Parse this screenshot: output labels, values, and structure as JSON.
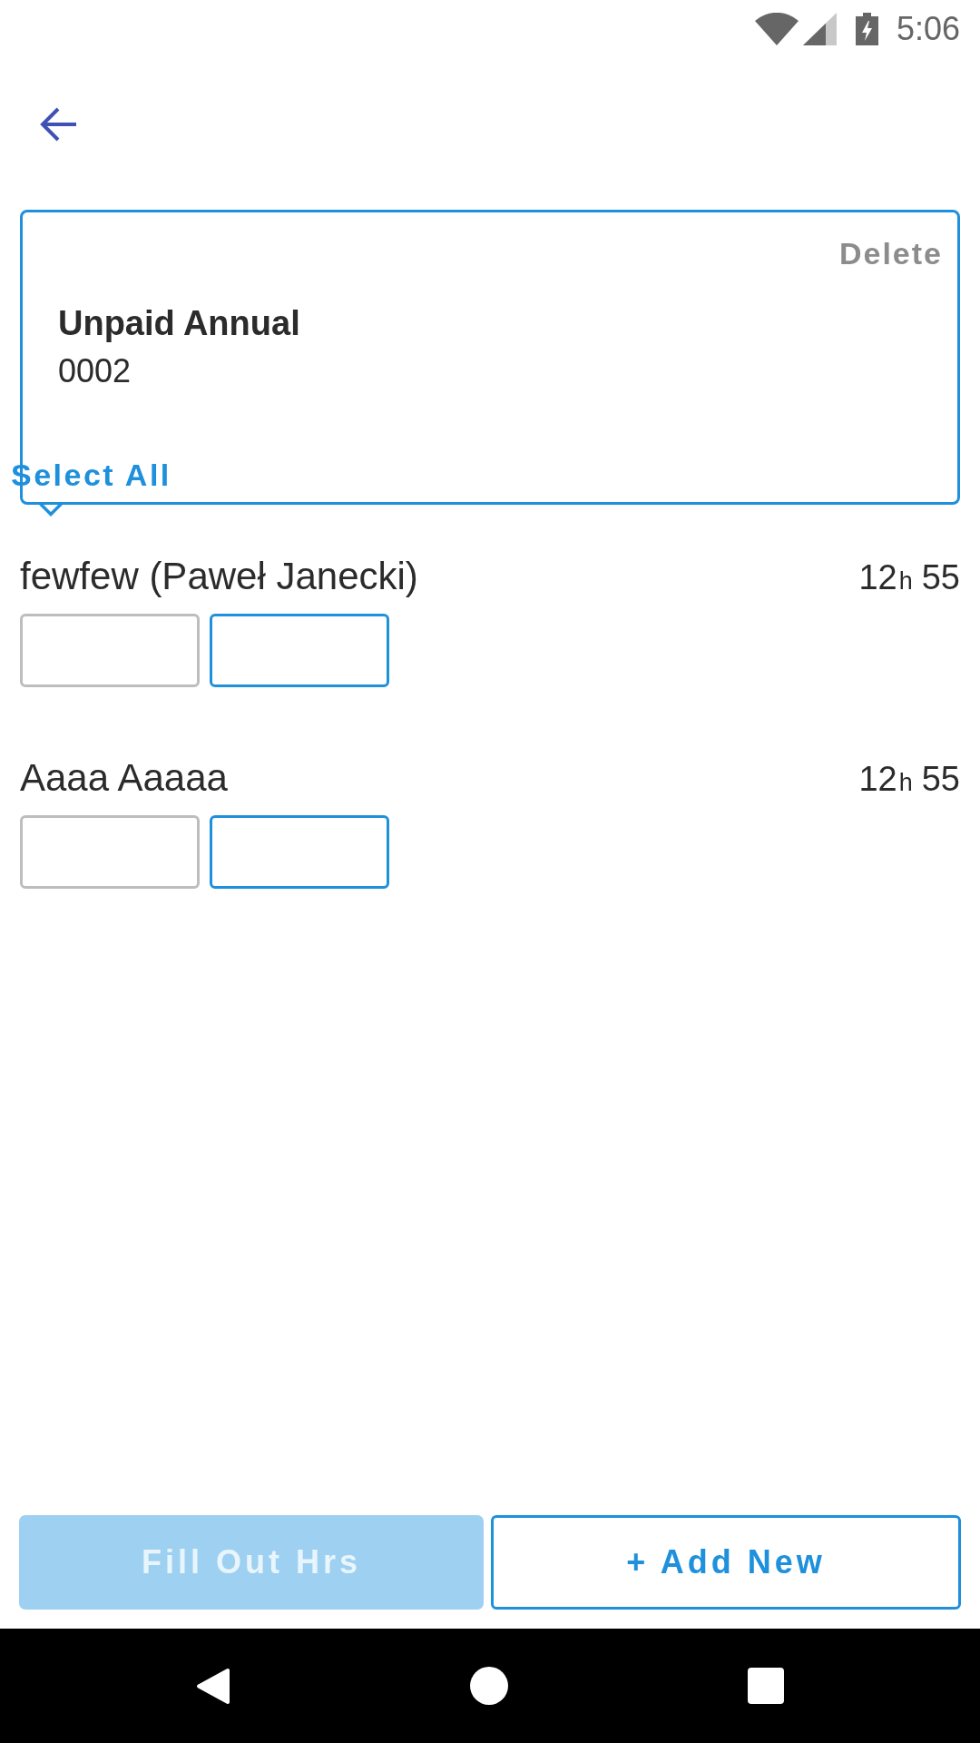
{
  "status_bar": {
    "time": "5:06"
  },
  "card": {
    "delete_label": "Delete",
    "title": "Unpaid Annual",
    "code": "0002",
    "select_all_label": "Select All"
  },
  "entries": [
    {
      "name": "fewfew (Paweł Janecki)",
      "hours": "12",
      "hours_unit": "h",
      "minutes": "55",
      "fields": [
        {
          "highlighted": false
        },
        {
          "highlighted": true
        }
      ]
    },
    {
      "name": "Aaaa Aaaaa",
      "hours": "12",
      "hours_unit": "h",
      "minutes": "55",
      "fields": [
        {
          "highlighted": false
        },
        {
          "highlighted": true
        }
      ]
    }
  ],
  "buttons": [
    {
      "label": "Fill Out Hrs",
      "kind": "filled",
      "disabled": true
    },
    {
      "label": "+ Add New",
      "kind": "outlined",
      "disabled": false
    }
  ]
}
